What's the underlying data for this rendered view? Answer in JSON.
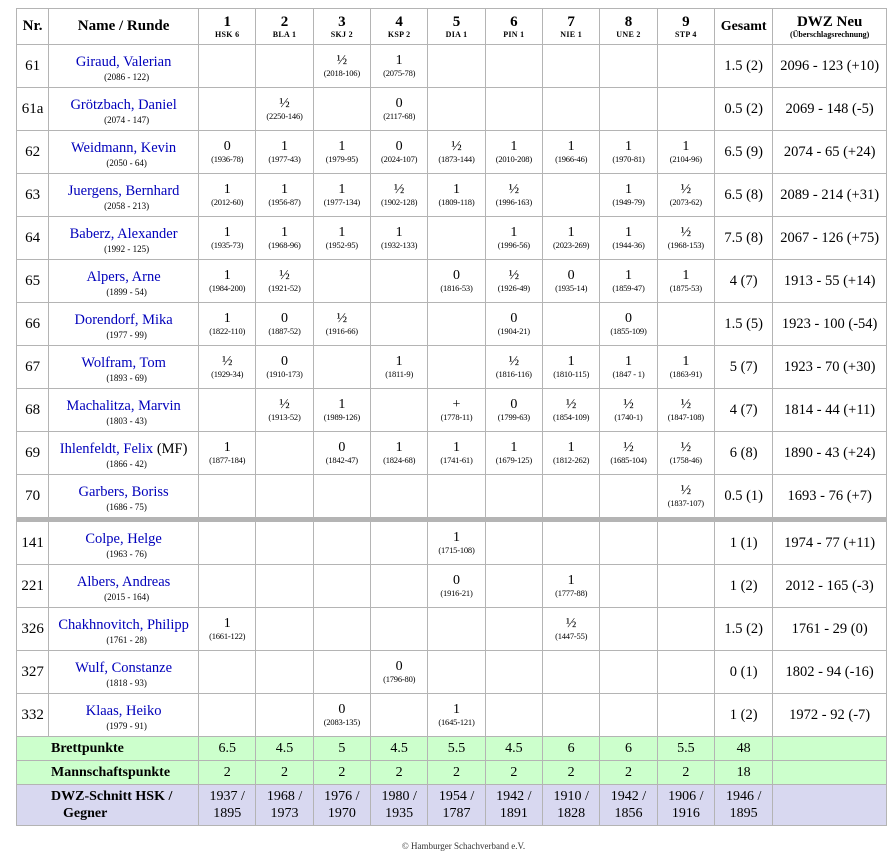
{
  "headers": {
    "nr": "Nr.",
    "name": "Name / Runde",
    "rounds": [
      {
        "num": "1",
        "team": "HSK 6"
      },
      {
        "num": "2",
        "team": "BLA 1"
      },
      {
        "num": "3",
        "team": "SKJ 2"
      },
      {
        "num": "4",
        "team": "KSP 2"
      },
      {
        "num": "5",
        "team": "DIA 1"
      },
      {
        "num": "6",
        "team": "PIN 1"
      },
      {
        "num": "7",
        "team": "NIE 1"
      },
      {
        "num": "8",
        "team": "UNE 2"
      },
      {
        "num": "9",
        "team": "STP 4"
      }
    ],
    "total": "Gesamt",
    "dwz_new": "DWZ Neu",
    "dwz_sub": "(Überschlagsrechnung)"
  },
  "players": [
    {
      "nr": "61",
      "name": "Giraud, Valerian",
      "mf": "",
      "dwz": "(2086 - 122)",
      "games": [
        null,
        null,
        {
          "r": "½",
          "o": "(2018-106)"
        },
        {
          "r": "1",
          "o": "(2075-78)"
        },
        null,
        null,
        null,
        null,
        null
      ],
      "total": "1.5 (2)",
      "new": "2096 - 123 (+10)"
    },
    {
      "nr": "61a",
      "name": "Grötzbach, Daniel",
      "mf": "",
      "dwz": "(2074 - 147)",
      "games": [
        null,
        {
          "r": "½",
          "o": "(2250-146)"
        },
        null,
        {
          "r": "0",
          "o": "(2117-68)"
        },
        null,
        null,
        null,
        null,
        null
      ],
      "total": "0.5 (2)",
      "new": "2069 - 148 (-5)"
    },
    {
      "nr": "62",
      "name": "Weidmann, Kevin",
      "mf": "",
      "dwz": "(2050 - 64)",
      "games": [
        {
          "r": "0",
          "o": "(1936-78)"
        },
        {
          "r": "1",
          "o": "(1977-43)"
        },
        {
          "r": "1",
          "o": "(1979-95)"
        },
        {
          "r": "0",
          "o": "(2024-107)"
        },
        {
          "r": "½",
          "o": "(1873-144)"
        },
        {
          "r": "1",
          "o": "(2010-208)"
        },
        {
          "r": "1",
          "o": "(1966-46)"
        },
        {
          "r": "1",
          "o": "(1970-81)"
        },
        {
          "r": "1",
          "o": "(2104-96)"
        }
      ],
      "total": "6.5 (9)",
      "new": "2074 - 65 (+24)"
    },
    {
      "nr": "63",
      "name": "Juergens, Bernhard",
      "mf": "",
      "dwz": "(2058 - 213)",
      "games": [
        {
          "r": "1",
          "o": "(2012-60)"
        },
        {
          "r": "1",
          "o": "(1956-87)"
        },
        {
          "r": "1",
          "o": "(1977-134)"
        },
        {
          "r": "½",
          "o": "(1902-128)"
        },
        {
          "r": "1",
          "o": "(1809-118)"
        },
        {
          "r": "½",
          "o": "(1996-163)"
        },
        null,
        {
          "r": "1",
          "o": "(1949-79)"
        },
        {
          "r": "½",
          "o": "(2073-62)"
        }
      ],
      "total": "6.5 (8)",
      "new": "2089 - 214 (+31)"
    },
    {
      "nr": "64",
      "name": "Baberz, Alexander",
      "mf": "",
      "dwz": "(1992 - 125)",
      "games": [
        {
          "r": "1",
          "o": "(1935-73)"
        },
        {
          "r": "1",
          "o": "(1968-96)"
        },
        {
          "r": "1",
          "o": "(1952-95)"
        },
        {
          "r": "1",
          "o": "(1932-133)"
        },
        null,
        {
          "r": "1",
          "o": "(1996-56)"
        },
        {
          "r": "1",
          "o": "(2023-269)"
        },
        {
          "r": "1",
          "o": "(1944-36)"
        },
        {
          "r": "½",
          "o": "(1968-153)"
        }
      ],
      "total": "7.5 (8)",
      "new": "2067 - 126 (+75)"
    },
    {
      "nr": "65",
      "name": "Alpers, Arne",
      "mf": "",
      "dwz": "(1899 - 54)",
      "games": [
        {
          "r": "1",
          "o": "(1984-200)"
        },
        {
          "r": "½",
          "o": "(1921-52)"
        },
        null,
        null,
        {
          "r": "0",
          "o": "(1816-53)"
        },
        {
          "r": "½",
          "o": "(1926-49)"
        },
        {
          "r": "0",
          "o": "(1935-14)"
        },
        {
          "r": "1",
          "o": "(1859-47)"
        },
        {
          "r": "1",
          "o": "(1875-53)"
        }
      ],
      "total": "4 (7)",
      "new": "1913 - 55 (+14)"
    },
    {
      "nr": "66",
      "name": "Dorendorf, Mika",
      "mf": "",
      "dwz": "(1977 - 99)",
      "games": [
        {
          "r": "1",
          "o": "(1822-110)"
        },
        {
          "r": "0",
          "o": "(1887-52)"
        },
        {
          "r": "½",
          "o": "(1916-66)"
        },
        null,
        null,
        {
          "r": "0",
          "o": "(1904-21)"
        },
        null,
        {
          "r": "0",
          "o": "(1855-109)"
        },
        null
      ],
      "total": "1.5 (5)",
      "new": "1923 - 100 (-54)"
    },
    {
      "nr": "67",
      "name": "Wolfram, Tom",
      "mf": "",
      "dwz": "(1893 - 69)",
      "games": [
        {
          "r": "½",
          "o": "(1929-34)"
        },
        {
          "r": "0",
          "o": "(1910-173)"
        },
        null,
        {
          "r": "1",
          "o": "(1811-9)"
        },
        null,
        {
          "r": "½",
          "o": "(1816-116)"
        },
        {
          "r": "1",
          "o": "(1810-115)"
        },
        {
          "r": "1",
          "o": "(1847 - 1)"
        },
        {
          "r": "1",
          "o": "(1863-91)"
        }
      ],
      "total": "5 (7)",
      "new": "1923 - 70 (+30)"
    },
    {
      "nr": "68",
      "name": "Machalitza, Marvin",
      "mf": "",
      "dwz": "(1803 - 43)",
      "games": [
        null,
        {
          "r": "½",
          "o": "(1913-52)"
        },
        {
          "r": "1",
          "o": "(1989-126)"
        },
        null,
        {
          "r": "+",
          "o": "(1778-11)"
        },
        {
          "r": "0",
          "o": "(1799-63)"
        },
        {
          "r": "½",
          "o": "(1854-109)"
        },
        {
          "r": "½",
          "o": "(1740-1)"
        },
        {
          "r": "½",
          "o": "(1847-108)"
        }
      ],
      "total": "4 (7)",
      "new": "1814 - 44 (+11)"
    },
    {
      "nr": "69",
      "name": "Ihlenfeldt, Felix",
      "mf": " (MF)",
      "dwz": "(1866 - 42)",
      "games": [
        {
          "r": "1",
          "o": "(1877-184)"
        },
        null,
        {
          "r": "0",
          "o": "(1842-47)"
        },
        {
          "r": "1",
          "o": "(1824-68)"
        },
        {
          "r": "1",
          "o": "(1741-61)"
        },
        {
          "r": "1",
          "o": "(1679-125)"
        },
        {
          "r": "1",
          "o": "(1812-262)"
        },
        {
          "r": "½",
          "o": "(1685-104)"
        },
        {
          "r": "½",
          "o": "(1758-46)"
        }
      ],
      "total": "6 (8)",
      "new": "1890 - 43 (+24)"
    },
    {
      "nr": "70",
      "name": "Garbers, Boriss",
      "mf": "",
      "dwz": "(1686 - 75)",
      "games": [
        null,
        null,
        null,
        null,
        null,
        null,
        null,
        null,
        {
          "r": "½",
          "o": "(1837-107)"
        }
      ],
      "total": "0.5 (1)",
      "new": "1693 - 76 (+7)"
    }
  ],
  "reserves": [
    {
      "nr": "141",
      "name": "Colpe, Helge",
      "mf": "",
      "dwz": "(1963 - 76)",
      "games": [
        null,
        null,
        null,
        null,
        {
          "r": "1",
          "o": "(1715-108)"
        },
        null,
        null,
        null,
        null
      ],
      "total": "1 (1)",
      "new": "1974 - 77 (+11)"
    },
    {
      "nr": "221",
      "name": "Albers, Andreas",
      "mf": "",
      "dwz": "(2015 - 164)",
      "games": [
        null,
        null,
        null,
        null,
        {
          "r": "0",
          "o": "(1916-21)"
        },
        null,
        {
          "r": "1",
          "o": "(1777-88)"
        },
        null,
        null
      ],
      "total": "1 (2)",
      "new": "2012 - 165 (-3)"
    },
    {
      "nr": "326",
      "name": "Chakhnovitch, Philipp",
      "mf": "",
      "dwz": "(1761 - 28)",
      "games": [
        {
          "r": "1",
          "o": "(1661-122)"
        },
        null,
        null,
        null,
        null,
        null,
        {
          "r": "½",
          "o": "(1447-55)"
        },
        null,
        null
      ],
      "total": "1.5 (2)",
      "new": "1761 - 29 (0)"
    },
    {
      "nr": "327",
      "name": "Wulf, Constanze",
      "mf": "",
      "dwz": "(1818 - 93)",
      "games": [
        null,
        null,
        null,
        {
          "r": "0",
          "o": "(1796-80)"
        },
        null,
        null,
        null,
        null,
        null
      ],
      "total": "0 (1)",
      "new": "1802 - 94 (-16)"
    },
    {
      "nr": "332",
      "name": "Klaas, Heiko",
      "mf": "",
      "dwz": "(1979 - 91)",
      "games": [
        null,
        null,
        {
          "r": "0",
          "o": "(2083-135)"
        },
        null,
        {
          "r": "1",
          "o": "(1645-121)"
        },
        null,
        null,
        null,
        null
      ],
      "total": "1 (2)",
      "new": "1972 - 92 (-7)"
    }
  ],
  "summary": {
    "board_points_label": "Brettpunkte",
    "board_points": [
      "6.5",
      "4.5",
      "5",
      "4.5",
      "5.5",
      "4.5",
      "6",
      "6",
      "5.5"
    ],
    "board_points_total": "48",
    "team_points_label": "Mannschaftspunkte",
    "team_points": [
      "2",
      "2",
      "2",
      "2",
      "2",
      "2",
      "2",
      "2",
      "2"
    ],
    "team_points_total": "18",
    "dwz_label_1": "DWZ-Schnitt HSK /",
    "dwz_label_2": "Gegner",
    "dwz_avg": [
      [
        "1937 /",
        "1895"
      ],
      [
        "1968 /",
        "1973"
      ],
      [
        "1976 /",
        "1970"
      ],
      [
        "1980 /",
        "1935"
      ],
      [
        "1954 /",
        "1787"
      ],
      [
        "1942 /",
        "1891"
      ],
      [
        "1910 /",
        "1828"
      ],
      [
        "1942 /",
        "1856"
      ],
      [
        "1906 /",
        "1916"
      ]
    ],
    "dwz_avg_total": [
      "1946 /",
      "1895"
    ]
  },
  "footer": "© Hamburger Schachverband e.V.",
  "colors": {
    "header_bg": "#d8d8f0",
    "green": "#ccffcc",
    "link": "#0000bb",
    "grid": "#b4b4b4"
  }
}
